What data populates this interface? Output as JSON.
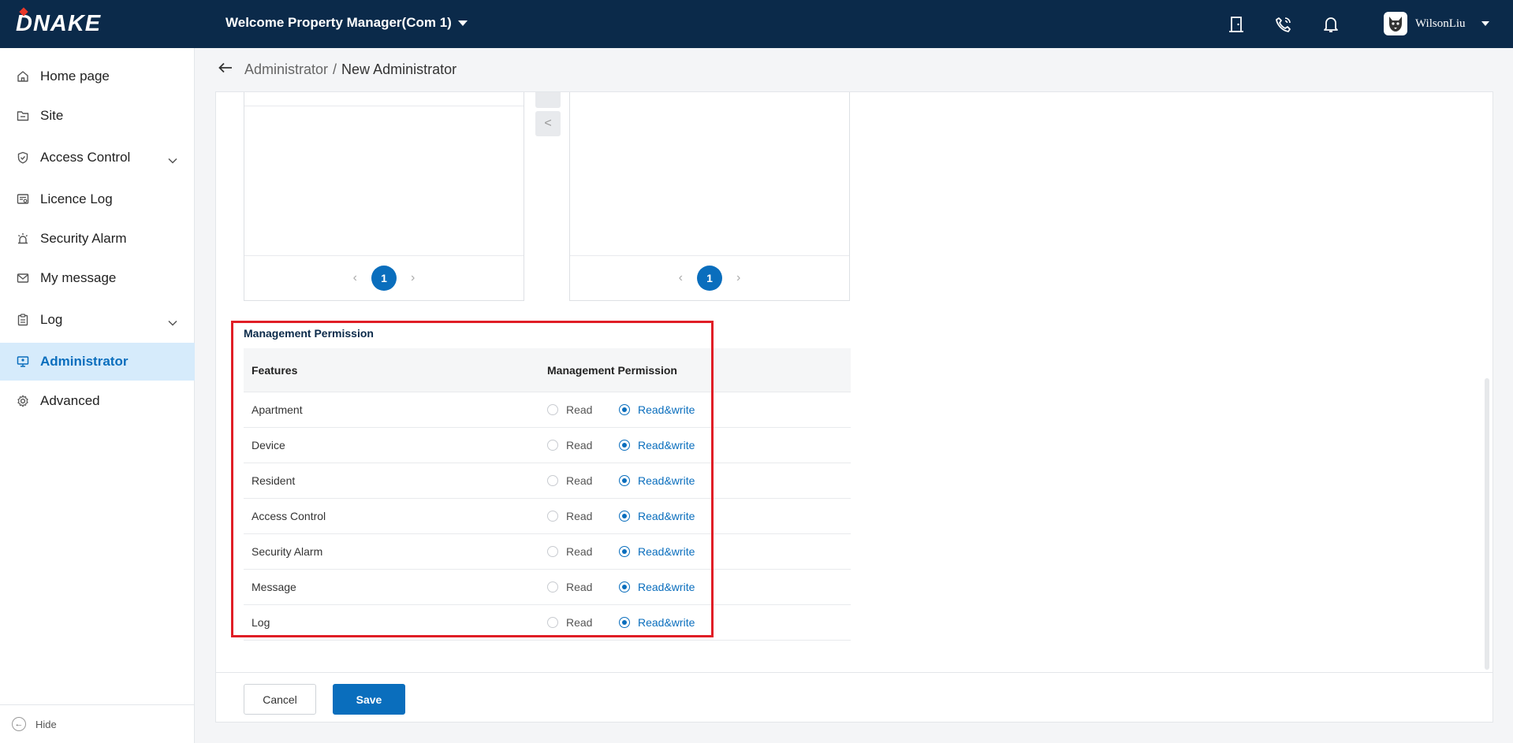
{
  "brand": {
    "logo": "DNAKE"
  },
  "header": {
    "welcome": "Welcome",
    "company": "Property Manager(Com 1)",
    "username": "WilsonLiu",
    "icons": [
      "door-icon",
      "phone-icon",
      "bell-icon"
    ]
  },
  "sidebar": {
    "items": [
      {
        "label": "Home page",
        "icon": "home-icon"
      },
      {
        "label": "Site",
        "icon": "folder-icon"
      },
      {
        "label": "Access Control",
        "icon": "shield-icon",
        "expandable": true
      },
      {
        "label": "Licence Log",
        "icon": "licence-icon"
      },
      {
        "label": "Security Alarm",
        "icon": "alarm-icon"
      },
      {
        "label": "My message",
        "icon": "mail-icon"
      },
      {
        "label": "Log",
        "icon": "clipboard-icon",
        "expandable": true
      },
      {
        "label": "Administrator",
        "icon": "monitor-icon",
        "active": true
      },
      {
        "label": "Advanced",
        "icon": "gear-icon"
      }
    ],
    "hide_label": "Hide"
  },
  "breadcrumb": {
    "parent": "Administrator",
    "separator": "/",
    "current": "New Administrator"
  },
  "transfer": {
    "left_page": "1",
    "right_page": "1",
    "move_left_symbol": "<"
  },
  "permissions": {
    "title": "Management Permission",
    "col_features": "Features",
    "col_permission": "Management Permission",
    "read_label": "Read",
    "readwrite_label": "Read&write",
    "rows": [
      {
        "feature": "Apartment",
        "selected": "readwrite"
      },
      {
        "feature": "Device",
        "selected": "readwrite"
      },
      {
        "feature": "Resident",
        "selected": "readwrite"
      },
      {
        "feature": "Access Control",
        "selected": "readwrite"
      },
      {
        "feature": "Security Alarm",
        "selected": "readwrite"
      },
      {
        "feature": "Message",
        "selected": "readwrite"
      },
      {
        "feature": "Log",
        "selected": "readwrite"
      }
    ]
  },
  "actions": {
    "cancel": "Cancel",
    "save": "Save"
  },
  "colors": {
    "primary": "#0a6ebd",
    "topbar": "#0b2a4a",
    "highlight": "#e01e26",
    "active_bg": "#d6ebfb"
  }
}
